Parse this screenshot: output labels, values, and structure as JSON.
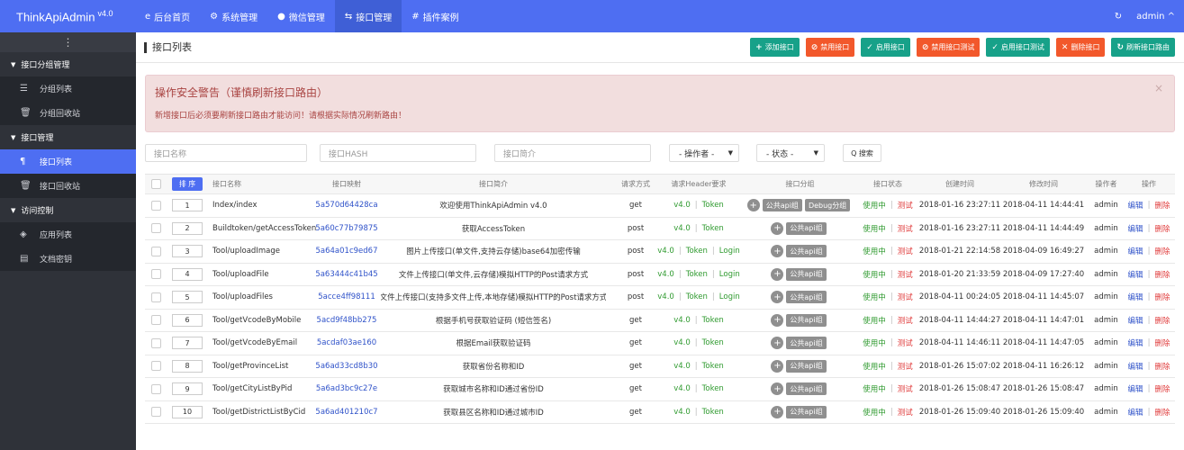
{
  "brand": {
    "name": "ThinkApiAdmin",
    "version": "v4.0"
  },
  "nav": [
    {
      "icon": "e",
      "label": "后台首页"
    },
    {
      "icon": "⚙",
      "label": "系统管理"
    },
    {
      "icon": "●",
      "label": "微信管理"
    },
    {
      "icon": "⇆",
      "label": "接口管理"
    },
    {
      "icon": "#",
      "label": "插件案例"
    }
  ],
  "topbar": {
    "refresh_icon": "↻",
    "user": "admin ^"
  },
  "sidebar": {
    "handle": "⋮",
    "group1": "接口分组管理",
    "item1": "分组列表",
    "item2": "分组回收站",
    "group2": "接口管理",
    "item3": "接口列表",
    "item4": "接口回收站",
    "group3": "访问控制",
    "item5": "应用列表",
    "item6": "文档密钥"
  },
  "page": {
    "title": "接口列表"
  },
  "actions": [
    {
      "icon": "+",
      "label": "添加接口"
    },
    {
      "icon": "⊘",
      "label": "禁用接口"
    },
    {
      "icon": "✓",
      "label": "启用接口"
    },
    {
      "icon": "⊘",
      "label": "禁用接口测试"
    },
    {
      "icon": "✓",
      "label": "启用接口测试"
    },
    {
      "icon": "✕",
      "label": "删除接口"
    },
    {
      "icon": "↻",
      "label": "刷新接口路由"
    }
  ],
  "alert": {
    "title": "操作安全警告（谨慎刷新接口路由）",
    "message": "新增接口后必须要刷新接口路由才能访问！请根据实际情况刷新路由！",
    "close": "×"
  },
  "filters": {
    "name_placeholder": "接口名称",
    "hash_placeholder": "接口HASH",
    "info_placeholder": "接口简介",
    "operator": "- 操作者 -",
    "status": "- 状态 -",
    "search": "Q 搜索",
    "arrow": "▼"
  },
  "table": {
    "headers": {
      "sort": "排 序",
      "name": "接口名称",
      "hash": "接口映射",
      "info": "接口简介",
      "method": "请求方式",
      "header_req": "请求Header要求",
      "group": "接口分组",
      "status": "接口状态",
      "created": "创建时间",
      "updated": "修改时间",
      "operator": "操作者",
      "ops": "操作"
    },
    "labels": {
      "version": "v4.0",
      "token": "Token",
      "login": "Login",
      "sep": "|",
      "plus": "+",
      "public_group": "公共api组",
      "debug_group": "Debug分组",
      "status_on": "使用中",
      "test": "测试",
      "edit": "编辑",
      "delete": "删除"
    },
    "rows": [
      {
        "sort": "1",
        "name": "Index/index",
        "hash": "5a570d64428ca",
        "info": "欢迎使用ThinkApiAdmin v4.0",
        "method": "get",
        "login": false,
        "debug": true,
        "created": "2018-01-16 23:27:11",
        "updated": "2018-04-11 14:44:41",
        "operator": "admin"
      },
      {
        "sort": "2",
        "name": "Buildtoken/getAccessToken",
        "hash": "5a60c77b79875",
        "info": "获取AccessToken",
        "method": "post",
        "login": false,
        "debug": false,
        "created": "2018-01-16 23:27:11",
        "updated": "2018-04-11 14:44:49",
        "operator": "admin"
      },
      {
        "sort": "3",
        "name": "Tool/uploadImage",
        "hash": "5a64a01c9ed67",
        "info": "图片上传接口(单文件,支持云存储)base64加密传输",
        "method": "post",
        "login": true,
        "debug": false,
        "created": "2018-01-21 22:14:58",
        "updated": "2018-04-09 16:49:27",
        "operator": "admin"
      },
      {
        "sort": "4",
        "name": "Tool/uploadFile",
        "hash": "5a63444c41b45",
        "info": "文件上传接口(单文件,云存储)模拟HTTP的Post请求方式",
        "method": "post",
        "login": true,
        "debug": false,
        "created": "2018-01-20 21:33:59",
        "updated": "2018-04-09 17:27:40",
        "operator": "admin"
      },
      {
        "sort": "5",
        "name": "Tool/uploadFiles",
        "hash": "5acce4ff98111",
        "info": "文件上传接口(支持多文件上传,本地存储)模拟HTTP的Post请求方式",
        "method": "post",
        "login": true,
        "debug": false,
        "created": "2018-04-11 00:24:05",
        "updated": "2018-04-11 14:45:07",
        "operator": "admin"
      },
      {
        "sort": "6",
        "name": "Tool/getVcodeByMobile",
        "hash": "5acd9f48bb275",
        "info": "根据手机号获取验证码 (短信签名)",
        "method": "get",
        "login": false,
        "debug": false,
        "created": "2018-04-11 14:44:27",
        "updated": "2018-04-11 14:47:01",
        "operator": "admin"
      },
      {
        "sort": "7",
        "name": "Tool/getVcodeByEmail",
        "hash": "5acdaf03ae160",
        "info": "根据Email获取验证码",
        "method": "get",
        "login": false,
        "debug": false,
        "created": "2018-04-11 14:46:11",
        "updated": "2018-04-11 14:47:05",
        "operator": "admin"
      },
      {
        "sort": "8",
        "name": "Tool/getProvinceList",
        "hash": "5a6ad33cd8b30",
        "info": "获取省份名称和ID",
        "method": "get",
        "login": false,
        "debug": false,
        "created": "2018-01-26 15:07:02",
        "updated": "2018-04-11 16:26:12",
        "operator": "admin"
      },
      {
        "sort": "9",
        "name": "Tool/getCityListByPid",
        "hash": "5a6ad3bc9c27e",
        "info": "获取城市名称和ID通过省份ID",
        "method": "get",
        "login": false,
        "debug": false,
        "created": "2018-01-26 15:08:47",
        "updated": "2018-01-26 15:08:47",
        "operator": "admin"
      },
      {
        "sort": "10",
        "name": "Tool/getDistrictListByCid",
        "hash": "5a6ad401210c7",
        "info": "获取县区名称和ID通过城市ID",
        "method": "get",
        "login": false,
        "debug": false,
        "created": "2018-01-26 15:09:40",
        "updated": "2018-01-26 15:09:40",
        "operator": "admin"
      }
    ]
  }
}
